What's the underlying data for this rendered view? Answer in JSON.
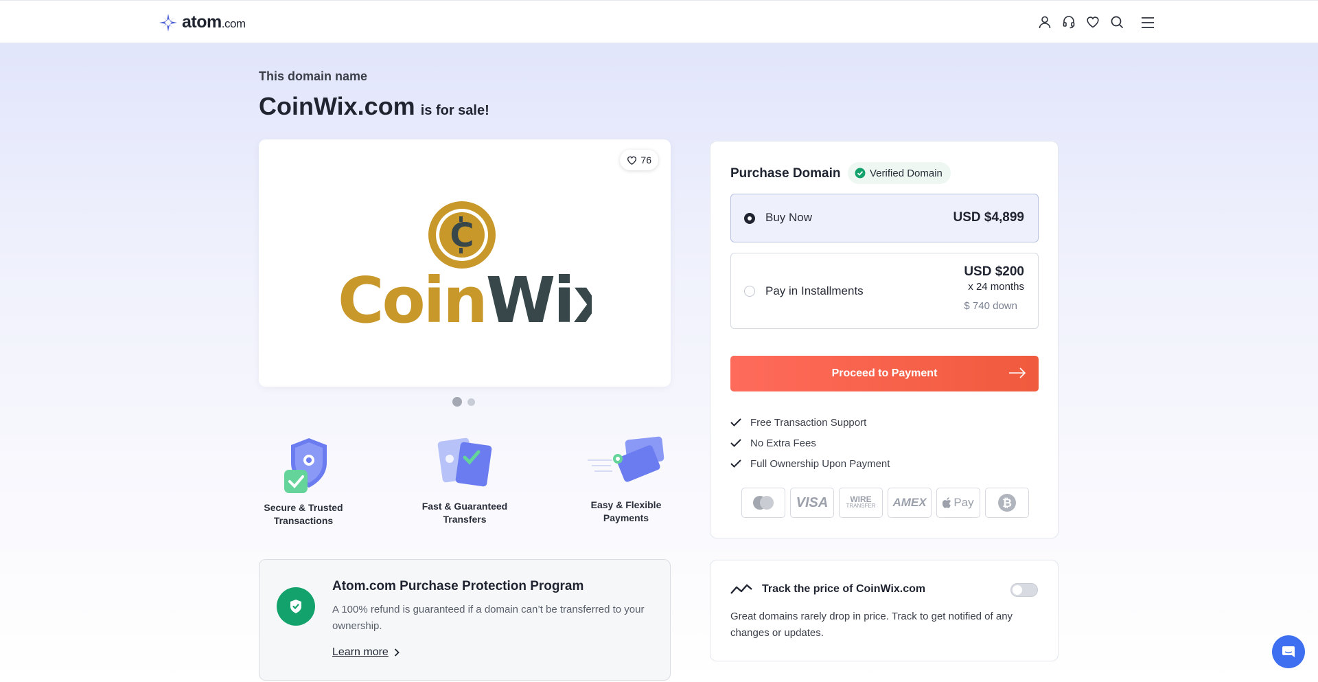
{
  "header": {
    "logo_word": "atom",
    "logo_tld": ".com",
    "icons": [
      "user-icon",
      "headset-icon",
      "heart-icon",
      "search-icon",
      "menu-icon"
    ]
  },
  "hero": {
    "eyebrow": "This domain name",
    "domain": "CoinWix.com",
    "suffix": "is for sale!"
  },
  "image_card": {
    "likes": "76",
    "logo_text_left": "Coin",
    "logo_text_right": "Wix",
    "logo_colors": {
      "gold": "#c8982b",
      "dark": "#37474a"
    },
    "carousel_count": 2,
    "carousel_active": 0
  },
  "features": [
    {
      "line1": "Secure & Trusted",
      "line2": "Transactions"
    },
    {
      "line1": "Fast & Guaranteed",
      "line2": "Transfers"
    },
    {
      "line1": "Easy & Flexible",
      "line2": "Payments"
    }
  ],
  "protection": {
    "title": "Atom.com Purchase Protection Program",
    "text": "A 100% refund is guaranteed if a domain can’t be transferred to your ownership.",
    "link": "Learn more"
  },
  "purchase": {
    "title": "Purchase Domain",
    "verified_badge": "Verified Domain",
    "options": {
      "buy_now": {
        "label": "Buy Now",
        "price": "USD $4,899",
        "selected": true
      },
      "installments": {
        "label": "Pay in Installments",
        "price": "USD $200",
        "months": "x 24 months",
        "down": "$ 740 down",
        "selected": false
      }
    },
    "cta": "Proceed to Payment",
    "perks": [
      "Free Transaction Support",
      "No Extra Fees",
      "Full Ownership Upon Payment"
    ],
    "payment_methods": [
      "mastercard-icon",
      "visa-icon",
      "wire-transfer-icon",
      "amex-icon",
      "apple-pay-icon",
      "bitcoin-icon"
    ],
    "payment_labels": {
      "visa": "VISA",
      "wire1": "WIRE",
      "wire2": "TRANSFER",
      "amex": "AMEX",
      "applepay": "Pay"
    }
  },
  "track": {
    "title": "Track the price of CoinWix.com",
    "text": "Great domains rarely drop in price. Track to get notified of any changes or updates.",
    "enabled": false
  },
  "colors": {
    "accent": "#f05a3d",
    "verified": "#13a26b",
    "brand": "#4b5ed6"
  }
}
